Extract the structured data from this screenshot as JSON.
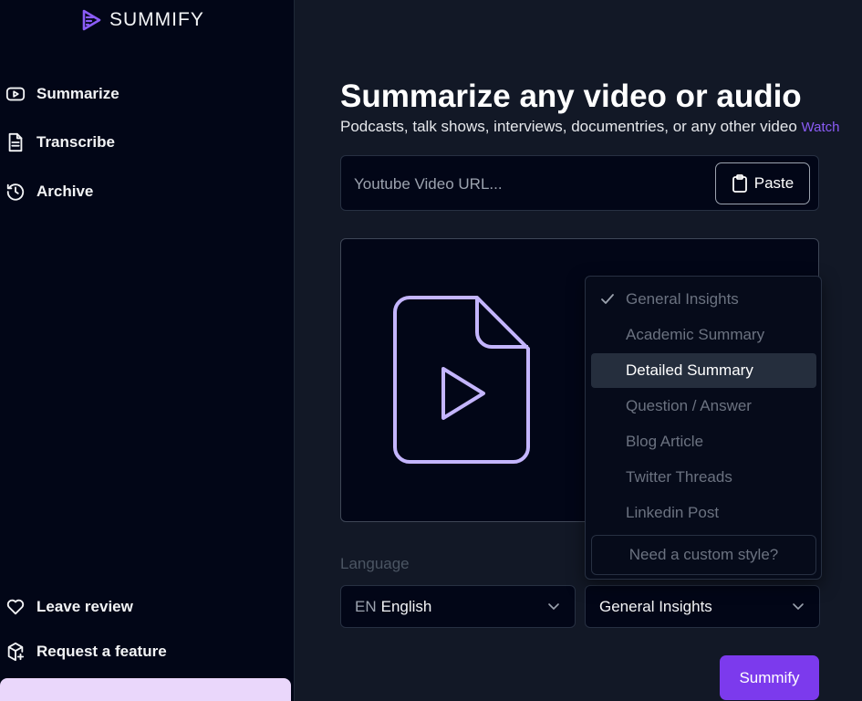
{
  "brand": {
    "name": "SUMMIFY",
    "color": "#8b5cf6"
  },
  "sidebar": {
    "items": [
      {
        "label": "Summarize",
        "icon": "video-play-icon"
      },
      {
        "label": "Transcribe",
        "icon": "document-icon"
      },
      {
        "label": "Archive",
        "icon": "history-icon"
      }
    ],
    "bottom_items": [
      {
        "label": "Leave review",
        "icon": "heart-icon"
      },
      {
        "label": "Request a feature",
        "icon": "package-plus-icon"
      }
    ]
  },
  "main": {
    "title": "Summarize any video or audio",
    "subtitle": "Podcasts, talk shows, interviews, documentries, or any other video",
    "watch_link": "Watch",
    "url_placeholder": "Youtube Video URL...",
    "paste_label": "Paste",
    "language_label": "Language",
    "language_code": "EN",
    "language_value": "English",
    "style_value": "General Insights",
    "submit_label": "Summify"
  },
  "dropdown": {
    "options": [
      {
        "label": "General Insights",
        "checked": true
      },
      {
        "label": "Academic Summary"
      },
      {
        "label": "Detailed Summary",
        "highlighted": true
      },
      {
        "label": "Question / Answer"
      },
      {
        "label": "Blog Article"
      },
      {
        "label": "Twitter Threads"
      },
      {
        "label": "Linkedin Post"
      }
    ],
    "custom_label": "Need a custom style?"
  },
  "colors": {
    "accent": "#7c3aed",
    "background": "#121826",
    "sidebar": "#020617",
    "file_icon": "#c4b5fd"
  }
}
